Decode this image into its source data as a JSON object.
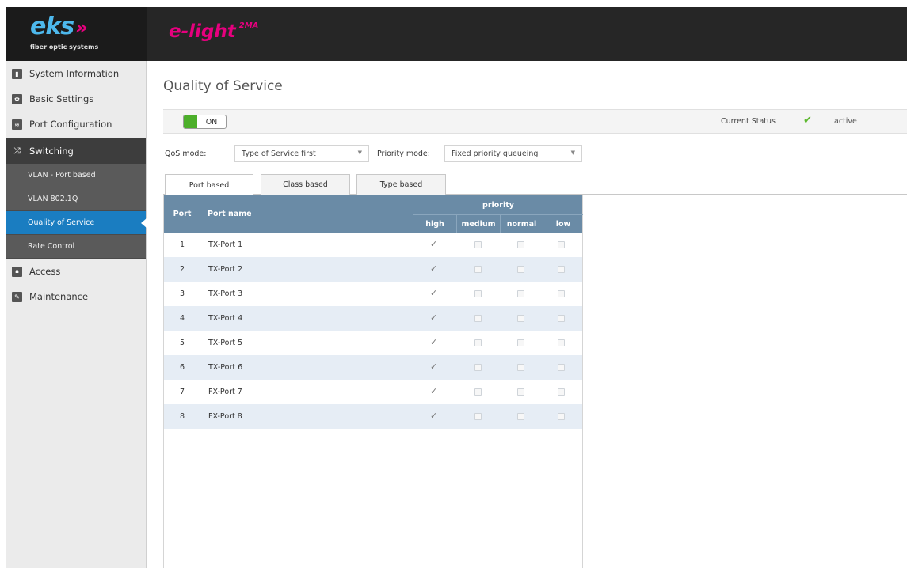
{
  "header": {
    "logo_text": "eks",
    "logo_arrows": "»",
    "logo_subtitle": "fiber optic systems",
    "product_name": "e-light",
    "product_suffix": "2MA"
  },
  "sidebar": {
    "items": [
      {
        "label": "System Information",
        "icon": "chart-icon"
      },
      {
        "label": "Basic Settings",
        "icon": "gear-icon"
      },
      {
        "label": "Port Configuration",
        "icon": "port-icon"
      },
      {
        "label": "Switching",
        "icon": "shuffle-icon"
      },
      {
        "label": "Access",
        "icon": "lock-icon"
      },
      {
        "label": "Maintenance",
        "icon": "wrench-icon"
      }
    ],
    "sub_items": [
      {
        "label": "VLAN - Port based"
      },
      {
        "label": "VLAN 802.1Q"
      },
      {
        "label": "Quality of Service"
      },
      {
        "label": "Rate Control"
      }
    ]
  },
  "page": {
    "title": "Quality of Service"
  },
  "status": {
    "toggle_label": "ON",
    "current_status_label": "Current Status",
    "current_status_value": "active"
  },
  "modes": {
    "qos_label": "QoS mode:",
    "qos_value": "Type of Service first",
    "priority_label": "Priority mode:",
    "priority_value": "Fixed priority queueing"
  },
  "tabs": [
    {
      "label": "Port based"
    },
    {
      "label": "Class based"
    },
    {
      "label": "Type based"
    }
  ],
  "table": {
    "col_port": "Port",
    "col_name": "Port name",
    "col_group": "priority",
    "col_high": "high",
    "col_medium": "medium",
    "col_normal": "normal",
    "col_low": "low",
    "rows": [
      {
        "port": "1",
        "name": "TX-Port 1",
        "priority": "high"
      },
      {
        "port": "2",
        "name": "TX-Port 2",
        "priority": "high"
      },
      {
        "port": "3",
        "name": "TX-Port 3",
        "priority": "high"
      },
      {
        "port": "4",
        "name": "TX-Port 4",
        "priority": "high"
      },
      {
        "port": "5",
        "name": "TX-Port 5",
        "priority": "high"
      },
      {
        "port": "6",
        "name": "TX-Port 6",
        "priority": "high"
      },
      {
        "port": "7",
        "name": "FX-Port 7",
        "priority": "high"
      },
      {
        "port": "8",
        "name": "FX-Port 8",
        "priority": "high"
      }
    ]
  },
  "colors": {
    "accent": "#1a7dc1",
    "brand_blue": "#4db8ec",
    "brand_magenta": "#e6007e",
    "table_header": "#6a8ba6",
    "toggle_on": "#4caf2a"
  }
}
